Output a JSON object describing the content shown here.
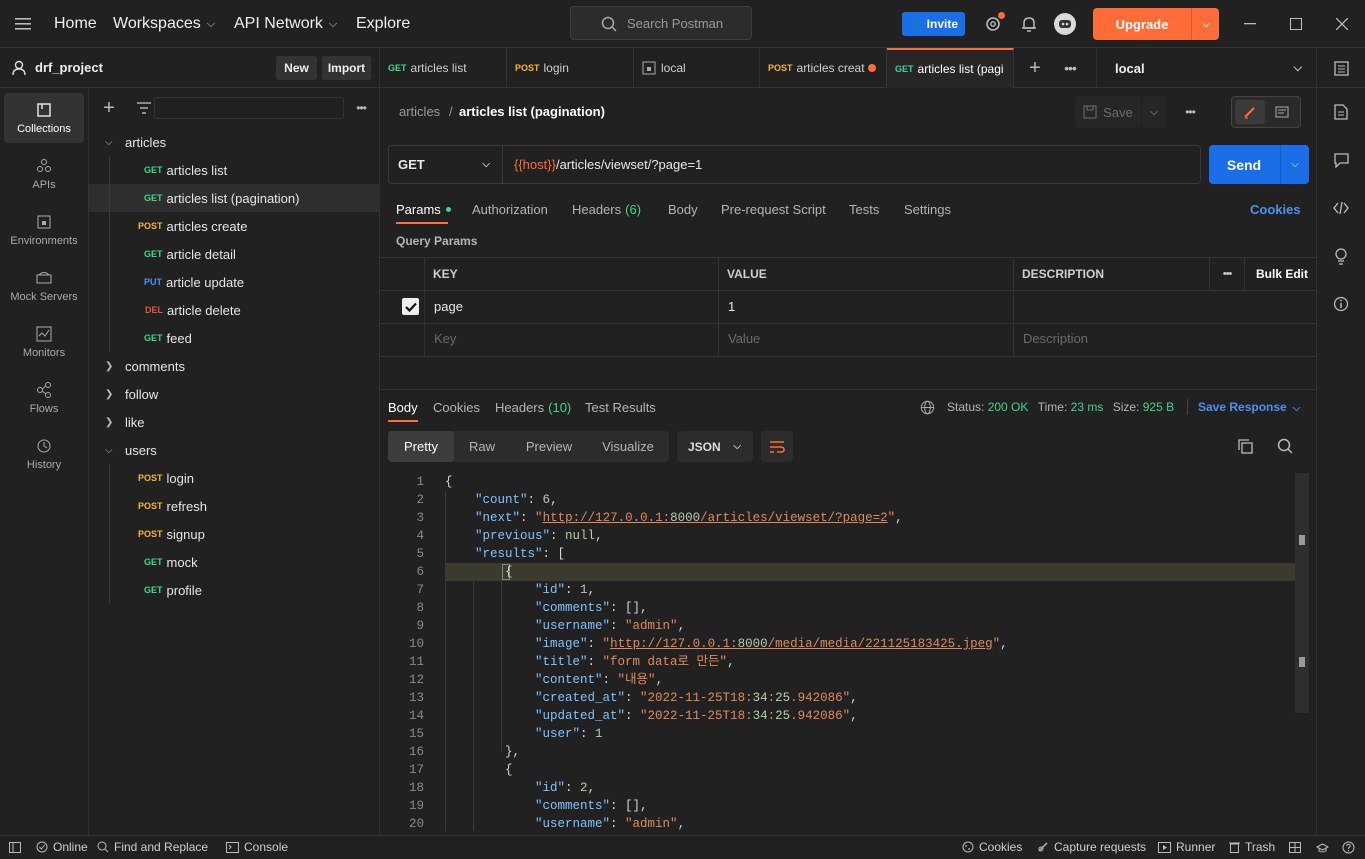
{
  "topbar": {
    "home": "Home",
    "workspaces": "Workspaces",
    "api_network": "API Network",
    "explore": "Explore",
    "search_placeholder": "Search Postman",
    "invite": "Invite",
    "upgrade": "Upgrade"
  },
  "workspace": {
    "name": "drf_project",
    "new": "New",
    "import": "Import"
  },
  "tabs": [
    {
      "method": "GET",
      "label": "articles list"
    },
    {
      "method": "POST",
      "label": "login"
    },
    {
      "method": "",
      "label": "local"
    },
    {
      "method": "POST",
      "label": "articles creat"
    },
    {
      "method": "GET",
      "label": "articles list (pagi"
    }
  ],
  "environment": "local",
  "rail": [
    {
      "label": "Collections"
    },
    {
      "label": "APIs"
    },
    {
      "label": "Environments"
    },
    {
      "label": "Mock Servers"
    },
    {
      "label": "Monitors"
    },
    {
      "label": "Flows"
    },
    {
      "label": "History"
    }
  ],
  "tree": [
    {
      "type": "folder",
      "label": "articles",
      "open": true
    },
    {
      "method": "GET",
      "label": "articles list"
    },
    {
      "method": "GET",
      "label": "articles list (pagination)"
    },
    {
      "method": "POST",
      "label": "articles create"
    },
    {
      "method": "GET",
      "label": "article detail"
    },
    {
      "method": "PUT",
      "label": "article update"
    },
    {
      "method": "DEL",
      "label": "article delete"
    },
    {
      "method": "GET",
      "label": "feed"
    },
    {
      "type": "folder",
      "label": "comments",
      "open": false
    },
    {
      "type": "folder",
      "label": "follow",
      "open": false
    },
    {
      "type": "folder",
      "label": "like",
      "open": false
    },
    {
      "type": "folder",
      "label": "users",
      "open": true
    },
    {
      "method": "POST",
      "label": "login"
    },
    {
      "method": "POST",
      "label": "refresh"
    },
    {
      "method": "POST",
      "label": "signup"
    },
    {
      "method": "GET",
      "label": "mock"
    },
    {
      "method": "GET",
      "label": "profile"
    }
  ],
  "breadcrumb": {
    "parent": "articles",
    "sep": "/",
    "current": "articles list (pagination)"
  },
  "save": "Save",
  "request": {
    "method": "GET",
    "url_host": "{{host}}",
    "url_path": "/articles/viewset/?page=1",
    "send": "Send"
  },
  "req_tabs": {
    "params": "Params",
    "authorization": "Authorization",
    "headers": "Headers",
    "headers_count": "(6)",
    "body": "Body",
    "prerequest": "Pre-request Script",
    "tests": "Tests",
    "settings": "Settings",
    "cookies": "Cookies"
  },
  "query_params": {
    "title": "Query Params",
    "key_h": "KEY",
    "value_h": "VALUE",
    "desc_h": "DESCRIPTION",
    "bulk_edit": "Bulk Edit",
    "rows": [
      {
        "key": "page",
        "value": "1",
        "desc": ""
      }
    ],
    "key_ph": "Key",
    "value_ph": "Value",
    "desc_ph": "Description"
  },
  "response": {
    "body": "Body",
    "cookies": "Cookies",
    "headers": "Headers",
    "headers_count": "(10)",
    "tests": "Test Results",
    "status_l": "Status:",
    "status": "200 OK",
    "time_l": "Time:",
    "time": "23 ms",
    "size_l": "Size:",
    "size": "925 B",
    "save": "Save Response",
    "pretty": "Pretty",
    "raw": "Raw",
    "preview": "Preview",
    "visualize": "Visualize",
    "format": "JSON"
  },
  "code": [
    [
      "1",
      "{"
    ],
    [
      "2",
      "    \"count\": 6,"
    ],
    [
      "3",
      "    \"next\": \"http://127.0.0.1:8000/articles/viewset/?page=2\","
    ],
    [
      "4",
      "    \"previous\": null,"
    ],
    [
      "5",
      "    \"results\": ["
    ],
    [
      "6",
      "        {"
    ],
    [
      "7",
      "            \"id\": 1,"
    ],
    [
      "8",
      "            \"comments\": [],"
    ],
    [
      "9",
      "            \"username\": \"admin\","
    ],
    [
      "10",
      "            \"image\": \"http://127.0.0.1:8000/media/media/221125183425.jpeg\","
    ],
    [
      "11",
      "            \"title\": \"form data로 만든\","
    ],
    [
      "12",
      "            \"content\": \"내용\","
    ],
    [
      "13",
      "            \"created_at\": \"2022-11-25T18:34:25.942086\","
    ],
    [
      "14",
      "            \"updated_at\": \"2022-11-25T18:34:25.942086\","
    ],
    [
      "15",
      "            \"user\": 1"
    ],
    [
      "16",
      "        },"
    ],
    [
      "17",
      "        {"
    ],
    [
      "18",
      "            \"id\": 2,"
    ],
    [
      "19",
      "            \"comments\": [],"
    ],
    [
      "20",
      "            \"username\": \"admin\","
    ]
  ],
  "statusbar": {
    "online": "Online",
    "find": "Find and Replace",
    "console": "Console",
    "cookies": "Cookies",
    "capture": "Capture requests",
    "runner": "Runner",
    "trash": "Trash"
  },
  "colors": {
    "accent": "#ff6c37",
    "blue": "#1c6ee8",
    "get": "#3dd68c",
    "post": "#f6b533"
  }
}
